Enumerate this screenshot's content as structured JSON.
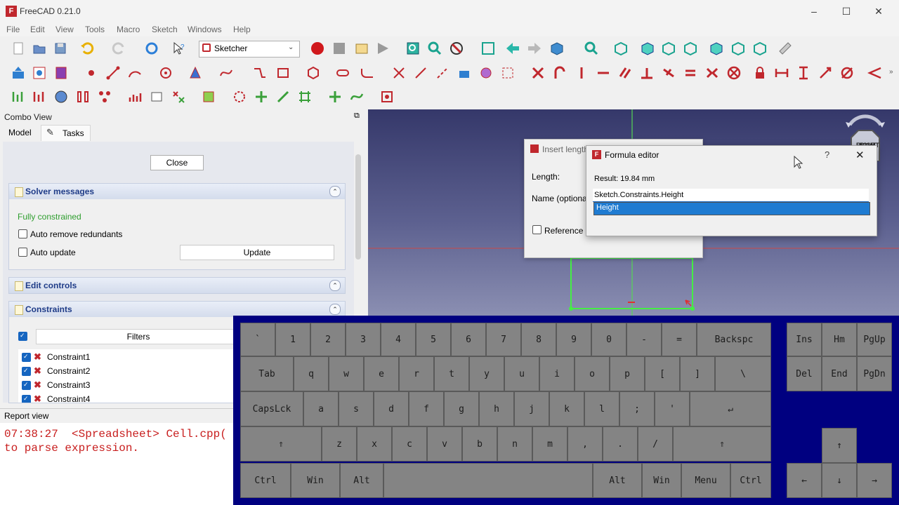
{
  "window": {
    "title": "FreeCAD 0.21.0",
    "logo_text": "F",
    "controls": [
      "–",
      "☐",
      "✕"
    ]
  },
  "menu": [
    "File",
    "Edit",
    "View",
    "Tools",
    "Macro",
    "Sketch",
    "Windows",
    "Help"
  ],
  "workbench": {
    "selected": "Sketcher"
  },
  "combo_view": {
    "title": "Combo View",
    "undock": "⧉",
    "tabs": [
      "Model",
      "Tasks"
    ],
    "close_label": "Close",
    "solver": {
      "title": "Solver messages",
      "status": "Fully constrained",
      "status_color": "#2e9e2e",
      "auto_remove": "Auto remove redundants",
      "auto_update": "Auto update",
      "update_label": "Update"
    },
    "edit_controls": {
      "title": "Edit controls"
    },
    "constraints": {
      "title": "Constraints",
      "filters_label": "Filters",
      "items": [
        "Constraint1",
        "Constraint2",
        "Constraint3",
        "Constraint4"
      ]
    },
    "collapse_glyph": "⌃"
  },
  "report": {
    "title": "Report view",
    "lines": [
      "07:38:27  <Spreadsheet> Cell.cpp(",
      "to parse expression."
    ]
  },
  "insert_dialog": {
    "title": "Insert length",
    "length_label": "Length:",
    "name_label": "Name (optional)",
    "reference_label": "Reference"
  },
  "formula_editor": {
    "title": "Formula editor",
    "help": "?",
    "close": "✕",
    "result": "Result: 19.84 mm",
    "input_value": "Sketch.Constraints.Height",
    "suggestion": "Height"
  },
  "nav_cube": {
    "face": "RIGHT"
  },
  "keyboard": {
    "rows": [
      [
        "`",
        "1",
        "2",
        "3",
        "4",
        "5",
        "6",
        "7",
        "8",
        "9",
        "0",
        "-",
        "=",
        "Backspc"
      ],
      [
        "Tab",
        "q",
        "w",
        "e",
        "r",
        "t",
        "y",
        "u",
        "i",
        "o",
        "p",
        "[",
        "]",
        "\\"
      ],
      [
        "CapsLck",
        "a",
        "s",
        "d",
        "f",
        "g",
        "h",
        "j",
        "k",
        "l",
        ";",
        "'",
        "↵"
      ],
      [
        "⇑",
        "z",
        "x",
        "c",
        "v",
        "b",
        "n",
        "m",
        ",",
        ".",
        "/",
        "⇑"
      ],
      [
        "Ctrl",
        "Win",
        "Alt",
        "",
        "Alt",
        "Win",
        "Menu",
        "Ctrl"
      ]
    ],
    "nav": [
      "Ins",
      "Hm",
      "PgUp",
      "Del",
      "End",
      "PgDn"
    ],
    "arrows": [
      "↑",
      "←",
      "↓",
      "→"
    ]
  },
  "colors": {
    "brand": "#c0272d",
    "accent": "#1f7bd1",
    "keyboard_bg": "#000080",
    "key": "#848484"
  }
}
